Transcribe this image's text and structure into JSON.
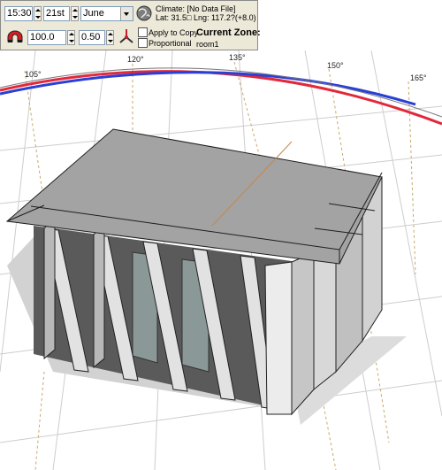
{
  "toolbar": {
    "time": "15:30",
    "day": "21st",
    "month": "June",
    "climate": "Climate: [No Data File]",
    "lat": "Lat: 31.5□",
    "lng": "Lng: 117.2?(+8.0)",
    "scale": "100.0",
    "factor": "0.50",
    "apply_to_copy": "Apply to Copy",
    "proportional": "Proportional",
    "current_zone_label": "Current Zone:",
    "current_zone_value": "room1"
  },
  "sun_path": {
    "labels": [
      "105°",
      "120°",
      "135°",
      "150°",
      "165°"
    ],
    "colors": {
      "winter": "#2a3fd6",
      "summer": "#e2283a"
    }
  }
}
